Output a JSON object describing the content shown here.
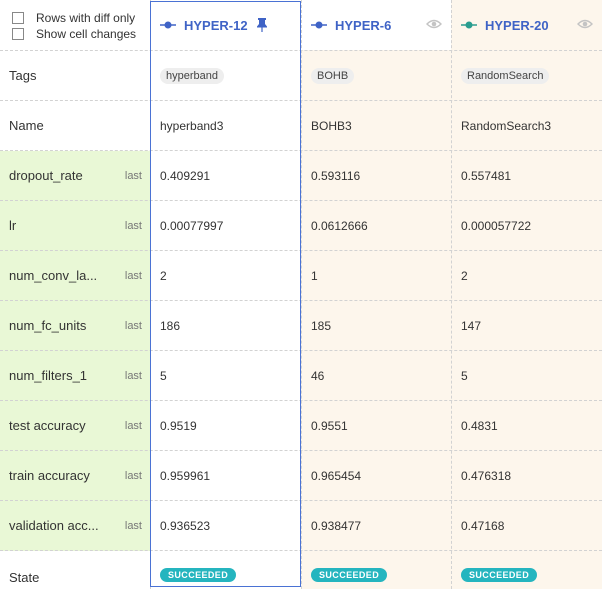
{
  "filters": {
    "rows_with_diff_only": "Rows with diff only",
    "show_cell_changes": "Show cell changes"
  },
  "runs": [
    {
      "id": "HYPER-12",
      "pinned": true,
      "color": "#3f63c6"
    },
    {
      "id": "HYPER-6",
      "pinned": false,
      "color": "#3f63c6"
    },
    {
      "id": "HYPER-20",
      "pinned": false,
      "color": "#2a9d8f"
    }
  ],
  "rows": {
    "tags": {
      "label": "Tags",
      "values": [
        "hyperband",
        "BOHB",
        "RandomSearch"
      ]
    },
    "name": {
      "label": "Name",
      "values": [
        "hyperband3",
        "BOHB3",
        "RandomSearch3"
      ]
    },
    "dropout_rate": {
      "label": "dropout_rate",
      "agg": "last",
      "values": [
        "0.409291",
        "0.593116",
        "0.557481"
      ]
    },
    "lr": {
      "label": "lr",
      "agg": "last",
      "values": [
        "0.00077997",
        "0.0612666",
        "0.000057722"
      ]
    },
    "num_conv_layers": {
      "label": "num_conv_la...",
      "agg": "last",
      "values": [
        "2",
        "1",
        "2"
      ]
    },
    "num_fc_units": {
      "label": "num_fc_units",
      "agg": "last",
      "values": [
        "186",
        "185",
        "147"
      ]
    },
    "num_filters_1": {
      "label": "num_filters_1",
      "agg": "last",
      "values": [
        "5",
        "46",
        "5"
      ]
    },
    "test_accuracy": {
      "label": "test accuracy",
      "agg": "last",
      "values": [
        "0.9519",
        "0.9551",
        "0.4831"
      ]
    },
    "train_accuracy": {
      "label": "train accuracy",
      "agg": "last",
      "values": [
        "0.959961",
        "0.965454",
        "0.476318"
      ]
    },
    "validation_accuracy": {
      "label": "validation acc...",
      "agg": "last",
      "values": [
        "0.936523",
        "0.938477",
        "0.47168"
      ]
    },
    "state": {
      "label": "State",
      "values": [
        "SUCCEEDED",
        "SUCCEEDED",
        "SUCCEEDED"
      ]
    }
  },
  "colors": {
    "accent": "#3f63c6",
    "metric_row_bg": "#e9f8d6",
    "diff_col_bg": "#fdf6ec",
    "badge": "#25b5bf"
  },
  "icons": {
    "run_marker": "experiment-node-icon",
    "pin": "pin-icon",
    "visibility": "eye-icon"
  }
}
